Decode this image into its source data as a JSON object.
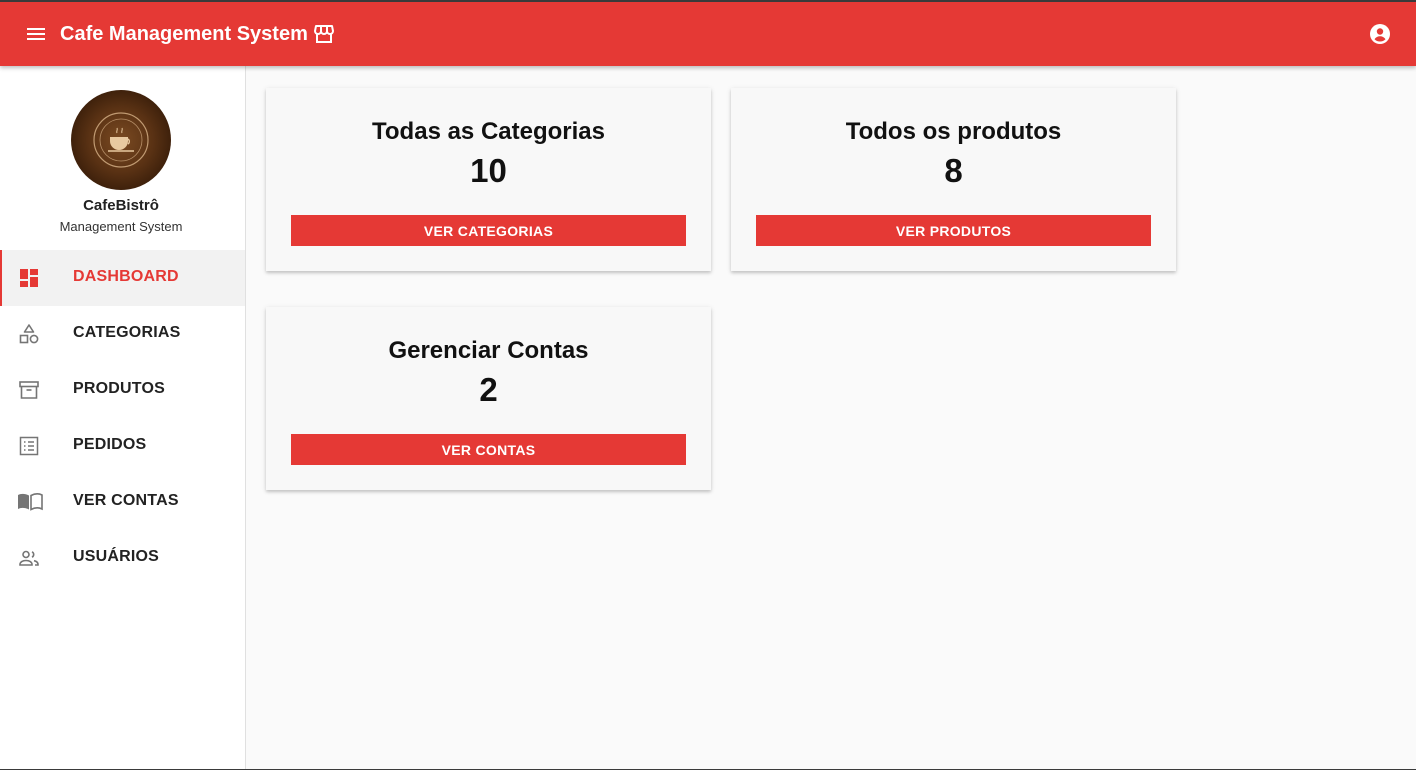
{
  "header": {
    "title": "Cafe Management System",
    "menu_icon": "menu-icon",
    "store_icon": "storefront-icon",
    "account_icon": "account-circle-icon",
    "bg_color": "#e53935"
  },
  "sidebar": {
    "brand_name": "CafeBistrô",
    "brand_subtitle": "Management System",
    "items": [
      {
        "label": "DASHBOARD",
        "icon": "dashboard-icon",
        "active": true
      },
      {
        "label": "CATEGORIAS",
        "icon": "category-icon",
        "active": false
      },
      {
        "label": "PRODUTOS",
        "icon": "inventory-icon",
        "active": false
      },
      {
        "label": "PEDIDOS",
        "icon": "list-alt-icon",
        "active": false
      },
      {
        "label": "VER CONTAS",
        "icon": "book-icon",
        "active": false
      },
      {
        "label": "USUÁRIOS",
        "icon": "people-icon",
        "active": false
      }
    ]
  },
  "cards": [
    {
      "title": "Todas as Categorias",
      "count": "10",
      "button": "VER CATEGORIAS"
    },
    {
      "title": "Todos os produtos",
      "count": "8",
      "button": "VER PRODUTOS"
    },
    {
      "title": "Gerenciar Contas",
      "count": "2",
      "button": "VER CONTAS"
    }
  ],
  "colors": {
    "accent": "#e53935",
    "text": "#222222"
  }
}
